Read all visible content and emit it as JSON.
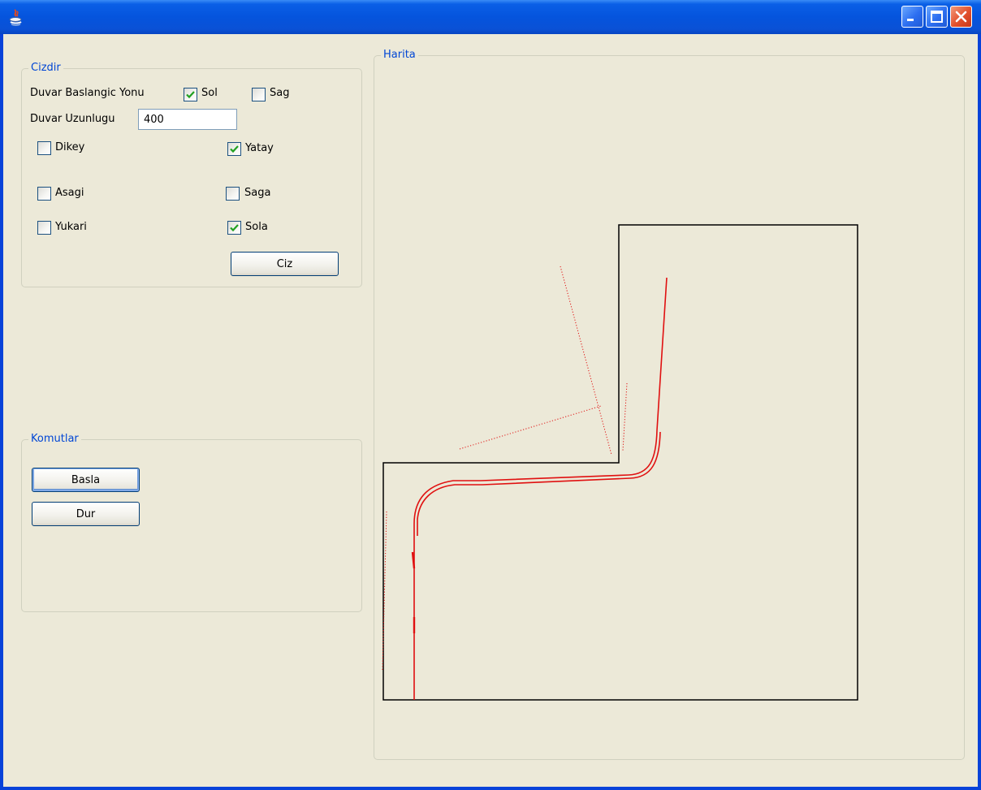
{
  "window": {
    "title": ""
  },
  "cizdir": {
    "title": "Cizdir",
    "start_direction_label": "Duvar Baslangic Yonu",
    "sol": {
      "label": "Sol",
      "checked": true
    },
    "sag": {
      "label": "Sag",
      "checked": false
    },
    "length_label": "Duvar Uzunlugu",
    "length_value": "400",
    "dikey": {
      "label": "Dikey",
      "checked": false
    },
    "yatay": {
      "label": "Yatay",
      "checked": true
    },
    "asagi": {
      "label": "Asagi",
      "checked": false
    },
    "saga": {
      "label": "Saga",
      "checked": false
    },
    "yukari": {
      "label": "Yukari",
      "checked": false
    },
    "sola": {
      "label": "Sola",
      "checked": true
    },
    "draw_button": "Ciz"
  },
  "komutlar": {
    "title": "Komutlar",
    "start_button": "Basla",
    "stop_button": "Dur"
  },
  "harita": {
    "title": "Harita",
    "wall_color": "#000000",
    "path_color": "#e01010"
  }
}
